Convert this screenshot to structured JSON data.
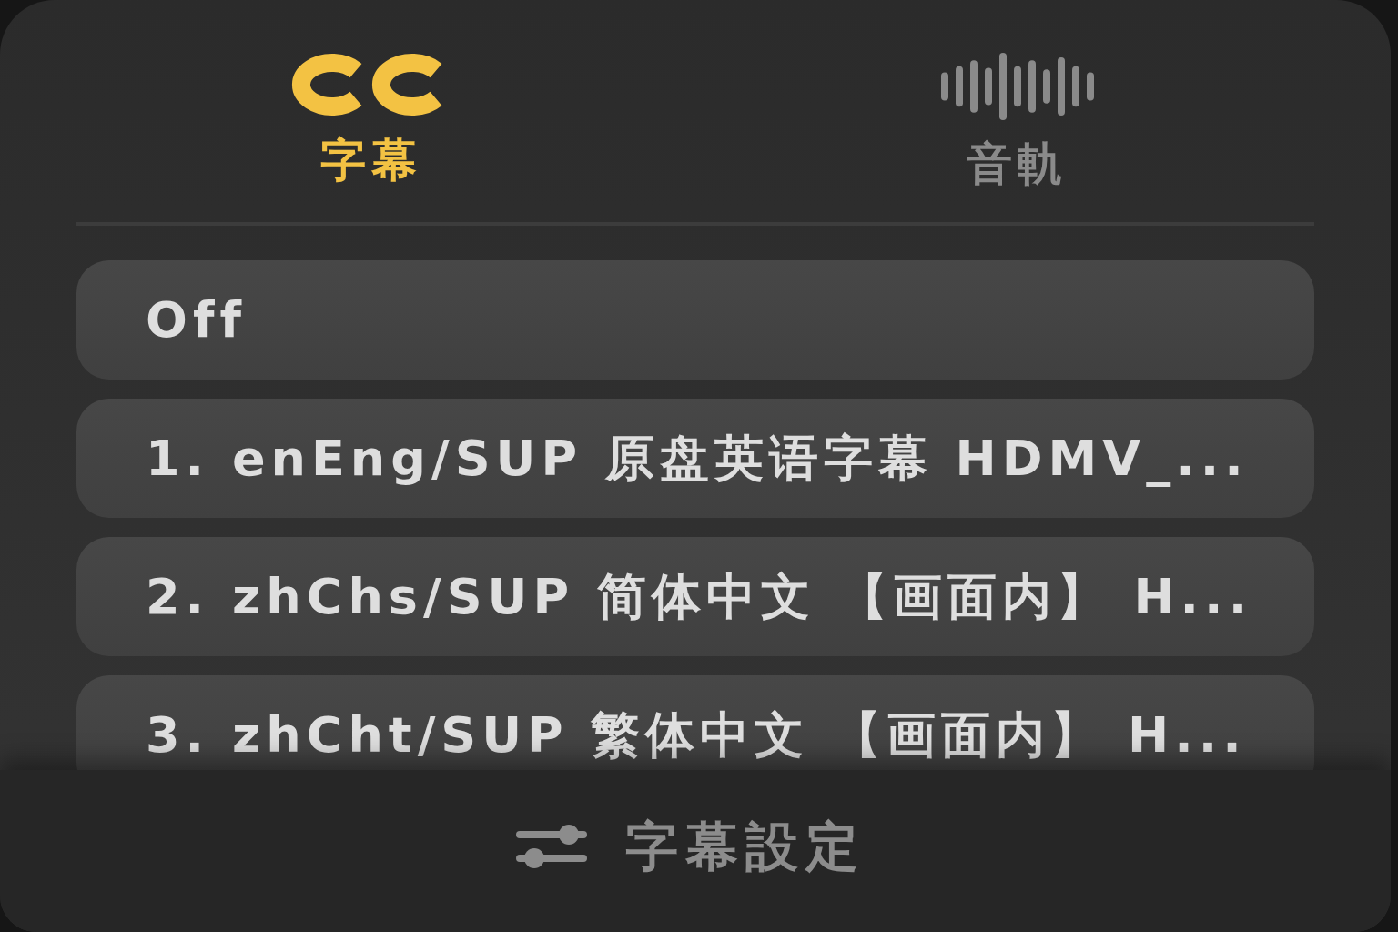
{
  "tabs": [
    {
      "kind": "captions",
      "label": "字幕",
      "selected": true
    },
    {
      "kind": "audio",
      "label": "音軌",
      "selected": false
    }
  ],
  "subtitle_options": [
    {
      "label": "Off"
    },
    {
      "label": "1. enEng/SUP 原盘英语字幕 HDMV_..."
    },
    {
      "label": "2. zhChs/SUP 简体中文 【画面内】 H..."
    },
    {
      "label": "3. zhCht/SUP 繁体中文 【画面内】 H..."
    }
  ],
  "settings_button": {
    "label": "字幕設定"
  }
}
